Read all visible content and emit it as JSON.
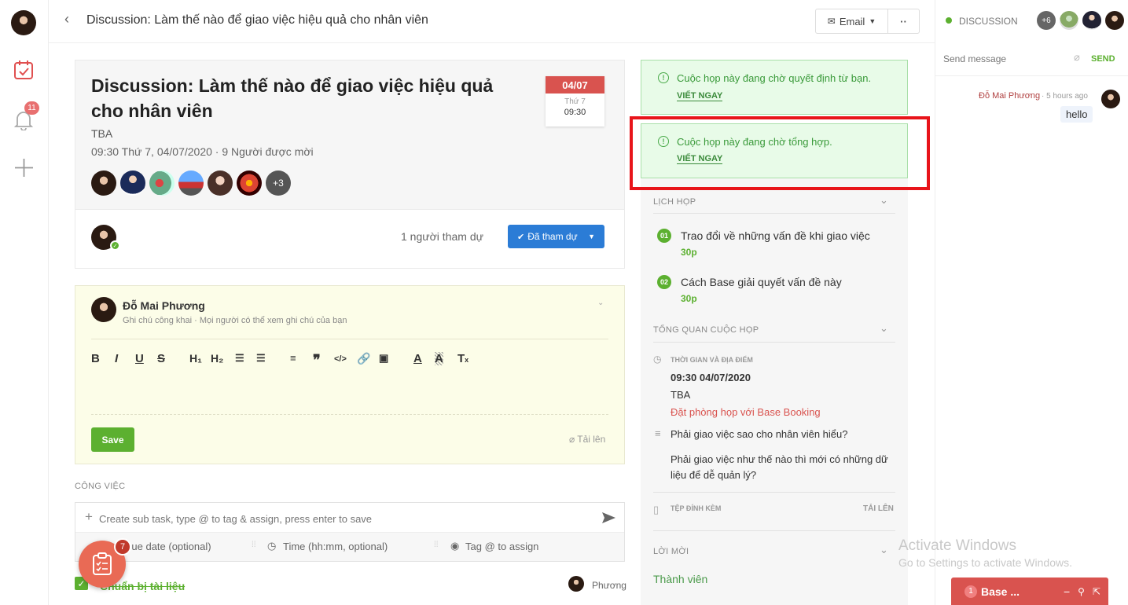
{
  "header": {
    "title": "Discussion: Làm thế nào để giao việc hiệu quả cho nhân viên",
    "email_label": "Email",
    "more_label": "··",
    "status_label": "DISCUSSION",
    "more_members": "+6"
  },
  "rail": {
    "notification_count": "11"
  },
  "meeting": {
    "title": "Discussion: Làm thế nào để giao việc hiệu quả cho nhân viên",
    "location": "TBA",
    "datetime_line": "09:30 Thứ 7, 04/07/2020 · 9 Người được mời",
    "extra_invitees": "+3",
    "date_badge_top": "04/07",
    "date_badge_day": "Thứ 7",
    "date_badge_time": "09:30",
    "attending_count": "1 người tham dự",
    "attend_button": "Đã tham dự"
  },
  "note": {
    "author": "Đỗ Mai Phương",
    "privacy": "Ghi chú công khai · Mọi người có thể xem ghi chú của bạn",
    "save_label": "Save",
    "upload_label": "Tải lên"
  },
  "tasks": {
    "section_label": "CÔNG VIỆC",
    "input_placeholder": "Create sub task, type @ to tag & assign, press enter to save",
    "due_date_placeholder": "Due date (optional)",
    "time_placeholder": "Time (hh:mm, optional)",
    "assign_placeholder": "Tag @ to assign",
    "task1_title": "Chuẩn bị tài liệu",
    "task1_assignee": "Phương",
    "fab_badge": "7"
  },
  "notices": [
    {
      "text": "Cuộc họp này đang chờ quyết định từ bạn.",
      "action": "VIẾT NGAY"
    },
    {
      "text": "Cuộc họp này đang chờ tổng hợp.",
      "action": "VIẾT NGAY"
    }
  ],
  "agenda": {
    "section_label": "LỊCH HỌP",
    "items": [
      {
        "num": "01",
        "title": "Trao đổi về những vấn đề khi giao việc",
        "duration": "30p"
      },
      {
        "num": "02",
        "title": "Cách Base giải quyết vấn đề này",
        "duration": "30p"
      }
    ]
  },
  "overview": {
    "section_label": "TỔNG QUAN CUỘC HỌP",
    "time_place_label": "THỜI GIAN VÀ ĐỊA ĐIỂM",
    "time": "09:30 04/07/2020",
    "location": "TBA",
    "booking_link": "Đặt phòng họp với Base Booking",
    "question1": "Phải giao việc sao cho nhân viên hiểu?",
    "question2": "Phải giao việc như thế nào thì mới có những dữ liệu để dễ quản lý?",
    "attachments_label": "TỆP ĐÍNH KÈM",
    "upload_label": "TẢI LÊN",
    "invite_label": "LỜI MỜI",
    "members_label": "Thành viên"
  },
  "chat": {
    "placeholder": "Send message",
    "send_label": "SEND",
    "message_author": "Đỗ Mai Phương",
    "message_time": "· 5 hours ago",
    "message_text": "hello"
  },
  "watermark": {
    "line1": "Activate Windows",
    "line2": "Go to Settings to activate Windows."
  },
  "minibar": {
    "count": "1",
    "label": "Base ..."
  },
  "colors": {
    "accent_red": "#e05050",
    "brand_green": "#5cb030",
    "attend_blue": "#2b7cd6",
    "highlight_box": "#e8141a"
  }
}
